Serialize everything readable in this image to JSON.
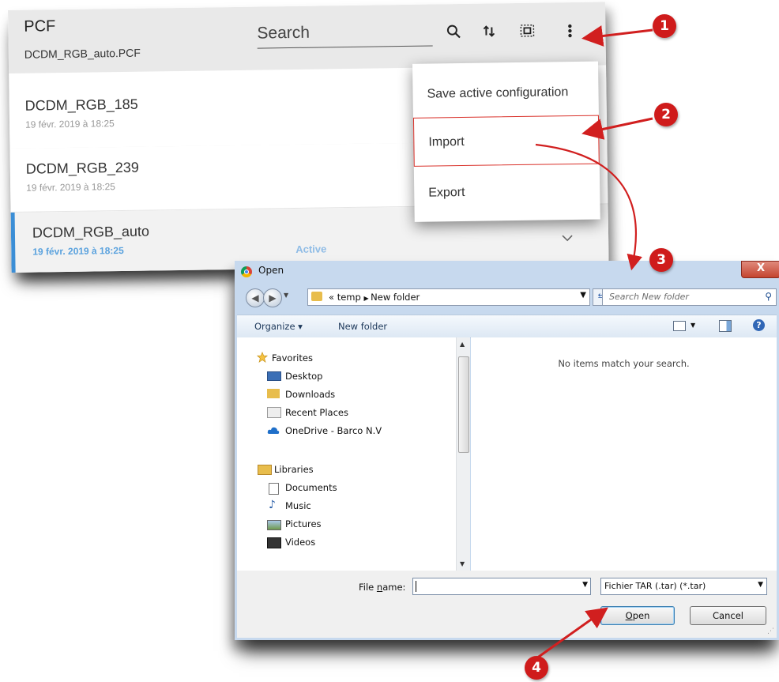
{
  "app": {
    "title": "PCF",
    "subtitle": "DCDM_RGB_auto.PCF",
    "search_placeholder": "Search",
    "header_icons": [
      "search-icon",
      "sort-icon",
      "select-all-icon",
      "more-vert-icon"
    ],
    "rows": [
      {
        "name": "DCDM_RGB_185",
        "date": "19 févr. 2019 à 18:25"
      },
      {
        "name": "DCDM_RGB_239",
        "date": "19 févr. 2019 à 18:25"
      },
      {
        "name": "DCDM_RGB_auto",
        "date": "19 févr. 2019 à 18:25",
        "status": "Active"
      }
    ],
    "menu": [
      "Save active configuration",
      "Import",
      "Export"
    ],
    "selected_menu_item": "Import"
  },
  "dialog": {
    "title": "Open",
    "close_label": "X",
    "address": {
      "prefix": "«",
      "crumbs": [
        "temp",
        "New folder"
      ]
    },
    "search_placeholder": "Search New folder",
    "toolbar": {
      "organize": "Organize ▾",
      "new_folder": "New folder",
      "help": "?"
    },
    "favorites_header": "Favorites",
    "favorites": [
      "Desktop",
      "Downloads",
      "Recent Places",
      "OneDrive - Barco N.V"
    ],
    "libraries_header": "Libraries",
    "libraries": [
      "Documents",
      "Music",
      "Pictures",
      "Videos"
    ],
    "empty_message": "No items match your search.",
    "file_name_label_pre": "File ",
    "file_name_label_u": "n",
    "file_name_label_post": "ame:",
    "file_name_value": "",
    "file_type": "Fichier TAR (.tar) (*.tar)",
    "open_label_pre": "",
    "open_label_u": "O",
    "open_label_post": "pen",
    "cancel_label": "Cancel"
  },
  "callouts": [
    "1",
    "2",
    "3",
    "4"
  ],
  "colors": {
    "accent_blue": "#3b8ed6",
    "callout_red": "#cf1b1b",
    "dialog_frame": "#c7d9ee"
  }
}
